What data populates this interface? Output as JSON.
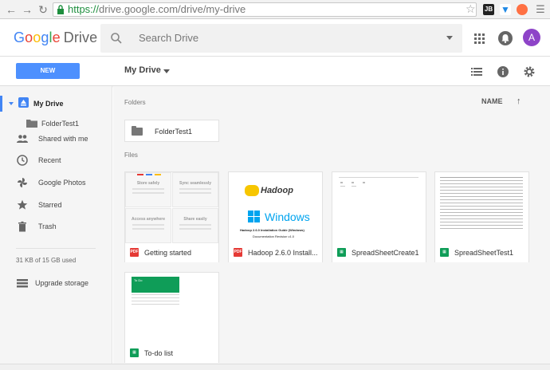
{
  "browser": {
    "url_scheme": "https://",
    "url_rest": "drive.google.com/drive/my-drive",
    "ext1_label": "JB"
  },
  "header": {
    "logo_g": [
      "G",
      "o",
      "o",
      "g",
      "l",
      "e"
    ],
    "logo_product": "Drive",
    "search_placeholder": "Search Drive",
    "avatar_initial": "A"
  },
  "toolbar": {
    "new_label": "NEW",
    "breadcrumb": "My Drive"
  },
  "sidebar": {
    "items": [
      {
        "label": "My Drive"
      },
      {
        "label": "FolderTest1"
      },
      {
        "label": "Shared with me"
      },
      {
        "label": "Recent"
      },
      {
        "label": "Google Photos"
      },
      {
        "label": "Starred"
      },
      {
        "label": "Trash"
      }
    ],
    "storage_text": "31 KB of 15 GB used",
    "upgrade_label": "Upgrade storage"
  },
  "main": {
    "folders_label": "Folders",
    "files_label": "Files",
    "sort_label": "NAME",
    "folders": [
      {
        "name": "FolderTest1"
      }
    ],
    "files": [
      {
        "name": "Getting started",
        "type": "PDF"
      },
      {
        "name": "Hadoop 2.6.0 Install...",
        "type": "PDF"
      },
      {
        "name": "SpreadSheetCreate1",
        "type": "sheet"
      },
      {
        "name": "SpreadSheetTest1",
        "type": "sheet"
      },
      {
        "name": "To-do list",
        "type": "sheet"
      }
    ],
    "getting_started_thumb": [
      "Store safely",
      "Sync seamlessly",
      "Access anywhere",
      "Share easily"
    ],
    "hadoop_thumb": {
      "brand": "Hadoop",
      "os": "Windows",
      "doc_title": "Hadoop 2.6.0 Installation Guide (Windows)",
      "revision": "Documentation Revision v1.0"
    },
    "todo_thumb_title": "To Do"
  }
}
